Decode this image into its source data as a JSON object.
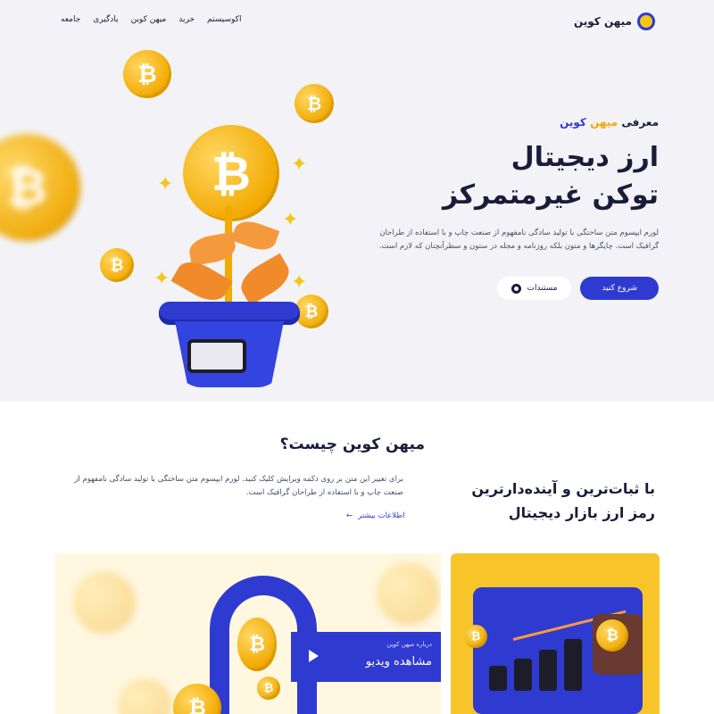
{
  "nav": {
    "logo_text": "میهن کوین",
    "menu": [
      "اکوسیستم",
      "خرید",
      "میهن کوین",
      "یادگیری",
      "جامعه"
    ]
  },
  "hero": {
    "intro_prefix": "معرفی",
    "intro_brand_a": "میهن",
    "intro_brand_b": "کوین",
    "title_line1": "ارز دیجیتال",
    "title_line2": "توکن غیرمتمرکز",
    "description": "لورم ایپسوم متن ساختگی با تولید سادگی نامفهوم از صنعت چاپ و با استفاده از طراحان گرافیک است. چاپگرها و متون بلکه روزنامه و مجله در ستون و سطرآنچنان که لازم است.",
    "primary_button": "شروع کنید",
    "secondary_button": "مستندات"
  },
  "about": {
    "title": "میهن کوین چیست؟",
    "heading_line1": "با ثبات‌ترین و آینده‌دارترین",
    "heading_line2": "رمز ارز بازار دیجیتال",
    "description": "برای تغییر این متن بر روی دکمه ویرایش کلیک کنید. لورم ایپسوم متن ساختگی با تولید سادگی نامفهوم از صنعت چاپ و با استفاده از طراحان گرافیک است.",
    "learn_more": "اطلاعات بیشتر",
    "learn_more_arrow": "←"
  },
  "video": {
    "small_label": "درباره میهن کوین",
    "big_label": "مشاهده ویدیو"
  },
  "coin_symbol": "₿",
  "colors": {
    "brand_blue": "#2e3ad0",
    "coin_gold": "#f2a900",
    "hero_bg": "#f3f3f7",
    "card_yellow": "#f7c42a"
  }
}
